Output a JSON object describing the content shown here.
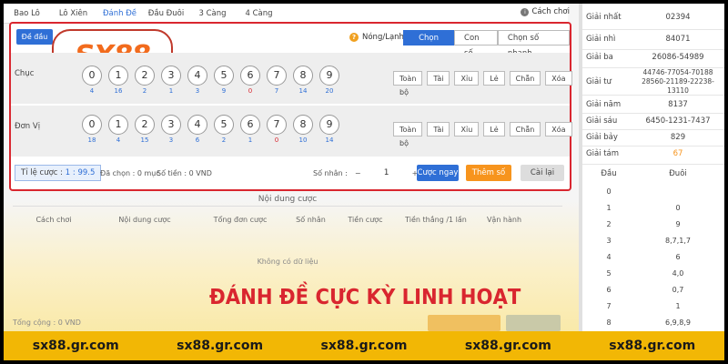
{
  "tabs": [
    {
      "label": "Bao Lô"
    },
    {
      "label": "Lô Xiên"
    },
    {
      "label": "Đánh Đề"
    },
    {
      "label": "Đầu Đuôi"
    },
    {
      "label": "3 Càng"
    },
    {
      "label": "4 Càng"
    }
  ],
  "howto_label": "Cách chơi",
  "panel": {
    "de_dau_label": "Đề đầu",
    "logo_text": "SX88",
    "hotcold_label": "Nóng/Lạnh",
    "modes": [
      "Chọn số",
      "Con số",
      "Chọn số nhanh"
    ],
    "rows": [
      {
        "label": "Chục",
        "numbers": [
          "0",
          "1",
          "2",
          "3",
          "4",
          "5",
          "6",
          "7",
          "8",
          "9"
        ],
        "misses": [
          "4",
          "16",
          "2",
          "1",
          "3",
          "9",
          "0",
          "7",
          "14",
          "20"
        ]
      },
      {
        "label": "Đơn Vị",
        "numbers": [
          "0",
          "1",
          "2",
          "3",
          "4",
          "5",
          "6",
          "7",
          "8",
          "9"
        ],
        "misses": [
          "18",
          "4",
          "15",
          "3",
          "6",
          "2",
          "1",
          "0",
          "10",
          "14"
        ]
      }
    ],
    "quick_buttons": [
      "Toàn bộ",
      "Tài",
      "Xỉu",
      "Lẻ",
      "Chẵn",
      "Xóa"
    ],
    "ratio_label": "Tỉ lệ cược :",
    "ratio_value": "1 : 99.5",
    "selected_label": "Đã chọn : 0 mục",
    "amount_label": "Số tiền : 0 VND",
    "multiplier_label": "Số nhân :",
    "multiplier_value": "1",
    "minus": "−",
    "plus": "+",
    "bet_now": "Cược ngay",
    "add_number": "Thêm số",
    "reset": "Cài lại"
  },
  "content": {
    "title": "Nội dung cược",
    "columns": [
      "Cách chơi",
      "Nội dung cược",
      "Tổng đơn cược",
      "Số nhân",
      "Tiền cược",
      "Tiền thắng /1 lần",
      "Vận hành"
    ],
    "empty": "Không có dữ liệu",
    "total": "Tổng cộng : 0 VND"
  },
  "banner": "ĐÁNH ĐỀ CỰC KỲ LINH HOẠT",
  "results": [
    {
      "label": "Giải nhất",
      "value": "02394"
    },
    {
      "label": "Giải nhì",
      "value": "84071"
    },
    {
      "label": "Giải ba",
      "value": "26086-54989"
    },
    {
      "label": "Giải tư",
      "value": "44746-77054-70188 28560-21189-22238-13110"
    },
    {
      "label": "Giải năm",
      "value": "8137"
    },
    {
      "label": "Giải sáu",
      "value": "6450-1231-7437"
    },
    {
      "label": "Giải bảy",
      "value": "829"
    },
    {
      "label": "Giải tám",
      "value": "67"
    }
  ],
  "dau_duoi": {
    "head_dau": "Đầu",
    "head_duoi": "Đuôi",
    "rows": [
      {
        "dau": "0",
        "duoi": ""
      },
      {
        "dau": "1",
        "duoi": "0"
      },
      {
        "dau": "2",
        "duoi": "9"
      },
      {
        "dau": "3",
        "duoi": "8,7,1,7"
      },
      {
        "dau": "4",
        "duoi": "6"
      },
      {
        "dau": "5",
        "duoi": "4,0"
      },
      {
        "dau": "6",
        "duoi": "0,7"
      },
      {
        "dau": "7",
        "duoi": "1"
      },
      {
        "dau": "8",
        "duoi": "6,9,8,9"
      }
    ]
  },
  "footer": [
    "sx88.gr.com",
    "sx88.gr.com",
    "sx88.gr.com",
    "sx88.gr.com",
    "sx88.gr.com"
  ],
  "colors": {
    "accent": "#2f6fd6",
    "highlight": "#d9262f",
    "footer": "#f2b705",
    "orange": "#f7941d"
  }
}
